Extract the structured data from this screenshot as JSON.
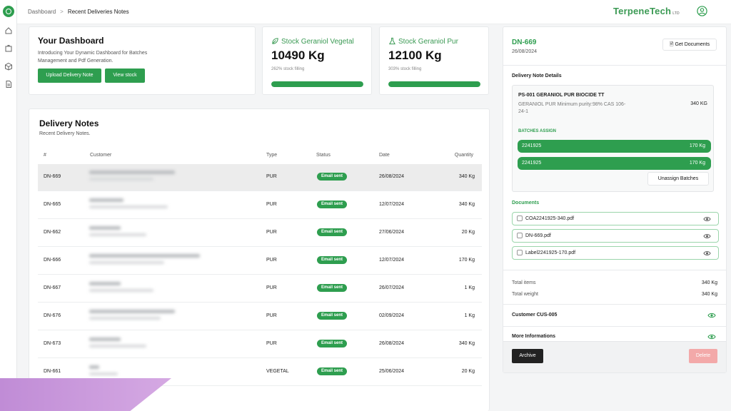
{
  "breadcrumb": {
    "root": "Dashboard",
    "current": "Recent Deliveries Notes"
  },
  "brand": {
    "name": "TerpeneTech",
    "suffix": "LTD"
  },
  "colors": {
    "accent": "#2e9e4f",
    "danger": "#f3a9a9",
    "dark": "#222222"
  },
  "dashboard": {
    "title": "Your Dashboard",
    "subtitle": "Introducing Your Dynamic Dashboard for Batches Management and Pdf Generation.",
    "upload_label": "Upload Delivery Note",
    "view_stock_label": "View stock"
  },
  "stats": [
    {
      "title": "Stock Geraniol Vegetal",
      "value": "10490 Kg",
      "fill_text": "262% stock filling",
      "fill_percent": 100
    },
    {
      "title": "Stock Geraniol Pur",
      "value": "12100 Kg",
      "fill_text": "303% stock filling",
      "fill_percent": 100
    }
  ],
  "delivery_notes": {
    "title": "Delivery Notes",
    "subtitle": "Recent Delivery Notes.",
    "columns": [
      "#",
      "Customer",
      "Type",
      "Status",
      "Date",
      "Quantity"
    ],
    "rows": [
      {
        "id": "DN-669",
        "type": "PUR",
        "status": "Email sent",
        "date": "26/08/2024",
        "qty": "340 Kg"
      },
      {
        "id": "DN-665",
        "type": "PUR",
        "status": "Email sent",
        "date": "12/07/2024",
        "qty": "340 Kg"
      },
      {
        "id": "DN-662",
        "type": "PUR",
        "status": "Email sent",
        "date": "27/06/2024",
        "qty": "20 Kg"
      },
      {
        "id": "DN-666",
        "type": "PUR",
        "status": "Email sent",
        "date": "12/07/2024",
        "qty": "170 Kg"
      },
      {
        "id": "DN-667",
        "type": "PUR",
        "status": "Email sent",
        "date": "26/07/2024",
        "qty": "1 Kg"
      },
      {
        "id": "DN-676",
        "type": "PUR",
        "status": "Email sent",
        "date": "02/09/2024",
        "qty": "1 Kg"
      },
      {
        "id": "DN-673",
        "type": "PUR",
        "status": "Email sent",
        "date": "26/08/2024",
        "qty": "340 Kg"
      },
      {
        "id": "DN-661",
        "type": "VEGETAL",
        "status": "Email sent",
        "date": "25/06/2024",
        "qty": "20 Kg"
      }
    ]
  },
  "detail": {
    "id": "DN-669",
    "date": "26/08/2024",
    "get_documents_label": "Get Documents",
    "details_label": "Delivery Note Details",
    "product_name": "PS-001 GERANIOL PUR BIOCIDE TT",
    "product_desc": "GERANIOL PUR Minimum purity:98% CAS 106-24-1",
    "product_qty": "340 KG",
    "batches_label": "BATCHES ASSIGN",
    "batches": [
      {
        "number": "2241925",
        "qty": "170 Kg"
      },
      {
        "number": "2241925",
        "qty": "170 Kg"
      }
    ],
    "unassign_label": "Unassign Batches",
    "documents_label": "Documents",
    "documents": [
      "COA2241925-340.pdf",
      "DN-669.pdf",
      "Label2241925-170.pdf"
    ],
    "total_items_label": "Total items",
    "total_items": "340 Kg",
    "total_weight_label": "Total weight",
    "total_weight": "340 Kg",
    "customer_label": "Customer CUS-005",
    "more_label": "More Informations",
    "archive_label": "Archive",
    "delete_label": "Delete"
  }
}
